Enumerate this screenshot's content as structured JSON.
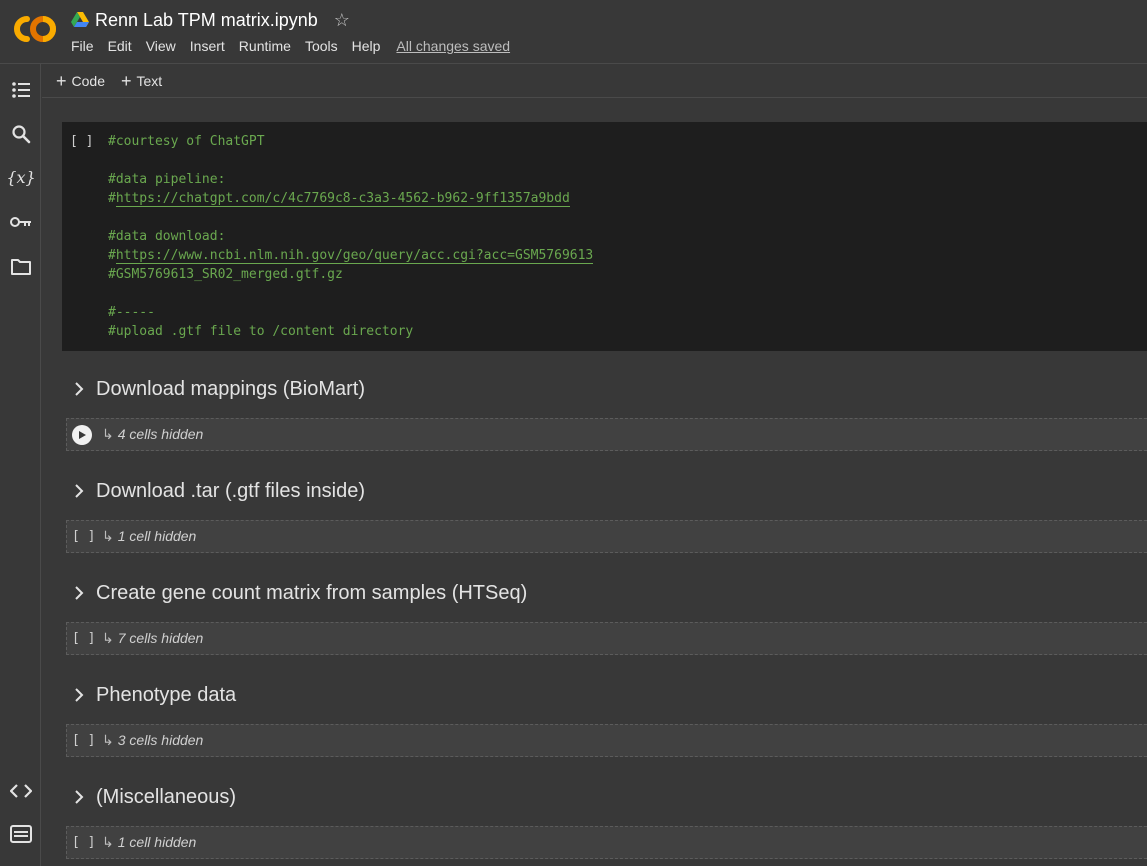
{
  "header": {
    "notebook_title": "Renn Lab TPM matrix.ipynb",
    "menu": [
      "File",
      "Edit",
      "View",
      "Insert",
      "Runtime",
      "Tools",
      "Help"
    ],
    "save_status": "All changes saved"
  },
  "toolbar": {
    "code_label": "Code",
    "text_label": "Text"
  },
  "rail": {
    "icons": [
      "table-of-contents-icon",
      "search-icon",
      "variables-icon",
      "secrets-key-icon",
      "files-folder-icon",
      "code-snippets-icon",
      "terminal-icon"
    ],
    "variables_glyph": "{x}"
  },
  "code_cell": {
    "run_bracket": "[ ]",
    "lines": [
      {
        "text": "#courtesy of ChatGPT",
        "link": false
      },
      {
        "text": "",
        "link": false
      },
      {
        "text": "#data pipeline:",
        "link": false
      },
      {
        "text": "#https://chatgpt.com/c/4c7769c8-c3a3-4562-b962-9ff1357a9bdd",
        "link": true,
        "prefix": "#",
        "url": "https://chatgpt.com/c/4c7769c8-c3a3-4562-b962-9ff1357a9bdd"
      },
      {
        "text": "",
        "link": false
      },
      {
        "text": "#data download:",
        "link": false
      },
      {
        "text": "#https://www.ncbi.nlm.nih.gov/geo/query/acc.cgi?acc=GSM5769613",
        "link": true,
        "prefix": "#",
        "url": "https://www.ncbi.nlm.nih.gov/geo/query/acc.cgi?acc=GSM5769613"
      },
      {
        "text": "#GSM5769613_SR02_merged.gtf.gz",
        "link": false
      },
      {
        "text": "",
        "link": false
      },
      {
        "text": "#-----",
        "link": false
      },
      {
        "text": "#upload .gtf file to /content directory",
        "link": false
      }
    ]
  },
  "sections": [
    {
      "title": "Download mappings (BioMart)",
      "hidden": "4 cells hidden",
      "control": "play"
    },
    {
      "title": "Download .tar (.gtf files inside)",
      "hidden": "1 cell hidden",
      "control": "[ ]"
    },
    {
      "title": "Create gene count matrix from samples (HTSeq)",
      "hidden": "7 cells hidden",
      "control": "[ ]"
    },
    {
      "title": "Phenotype data",
      "hidden": "3 cells hidden",
      "control": "[ ]"
    },
    {
      "title": "(Miscellaneous)",
      "hidden": "1 cell hidden",
      "control": "[ ]"
    }
  ],
  "colors": {
    "background": "#383838",
    "code_bg": "#1e1e1e",
    "comment_green": "#6aa84f",
    "logo_orange": "#f9ab00",
    "logo_dark_orange": "#e37400"
  }
}
